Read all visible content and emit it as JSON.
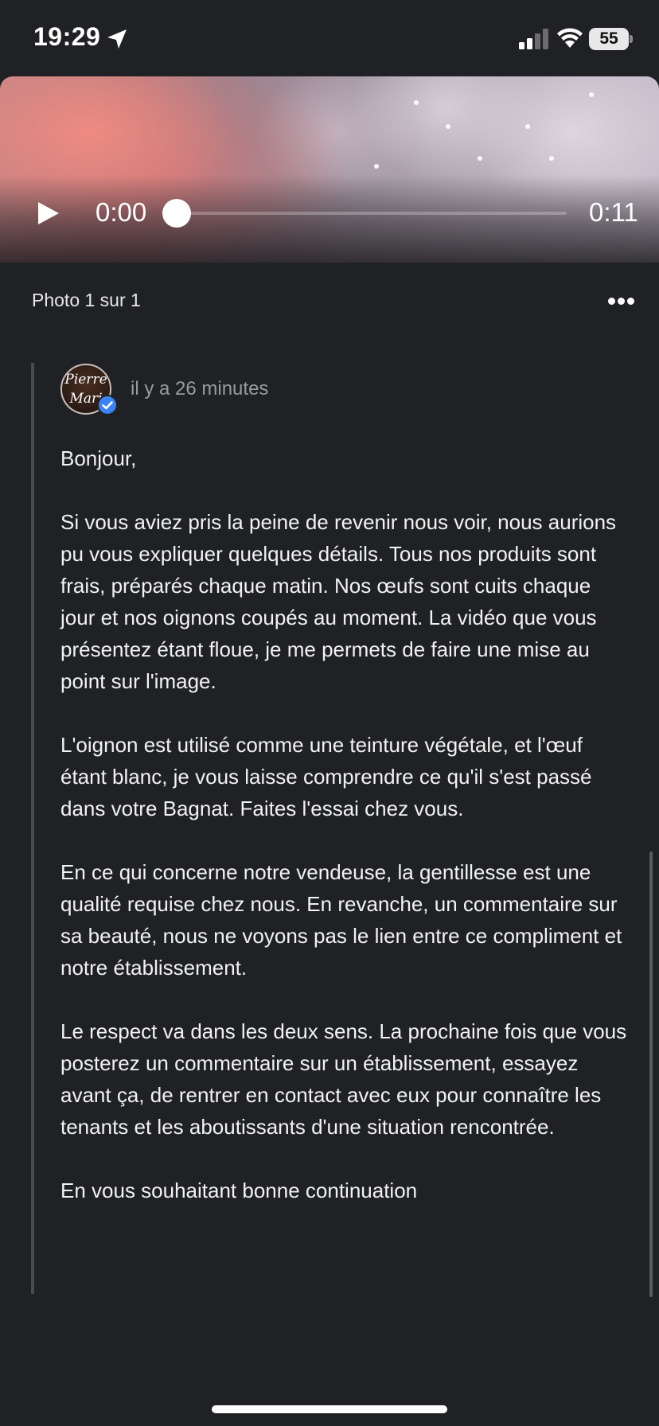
{
  "status_bar": {
    "time": "19:29",
    "battery": "55"
  },
  "video": {
    "current_time": "0:00",
    "total_time": "0:11",
    "progress": 0
  },
  "photo_bar": {
    "counter": "Photo 1 sur 1"
  },
  "reply": {
    "avatar_text_1": "Pierre",
    "avatar_text_2": "Mari",
    "time_ago": "il y a 26 minutes",
    "paragraphs": [
      "Bonjour,",
      "Si vous aviez pris la peine de revenir nous voir, nous aurions pu vous expliquer quelques détails. Tous nos produits sont frais, préparés chaque matin. Nos œufs sont cuits chaque jour et nos oignons coupés au moment. La vidéo que vous présentez étant floue, je me permets de faire une mise au point sur l'image.",
      "L'oignon est utilisé comme une teinture végétale, et l'œuf étant blanc, je vous laisse comprendre ce qu'il s'est passé dans votre Bagnat. Faites l'essai chez vous.",
      "En ce qui concerne notre vendeuse, la gentillesse est une qualité requise chez nous. En revanche, un commentaire sur sa beauté, nous ne voyons pas le lien entre ce compliment et notre établissement.",
      "Le respect va dans les deux sens. La prochaine fois que vous posterez un commentaire sur un établissement, essayez avant ça, de rentrer en contact avec eux pour connaître les tenants et les aboutissants d'une situation rencontrée.",
      "En vous souhaitant bonne continuation"
    ]
  },
  "icons": {
    "location": "location-arrow-icon",
    "signal": "cellular-signal-icon",
    "wifi": "wifi-icon",
    "play": "play-icon",
    "more": "more-horizontal-icon",
    "verified": "verified-badge-icon"
  },
  "colors": {
    "background": "#202124",
    "text_secondary": "#9a9ba0",
    "verified_blue": "#3b82f6",
    "reply_rule": "#4a4b50"
  }
}
